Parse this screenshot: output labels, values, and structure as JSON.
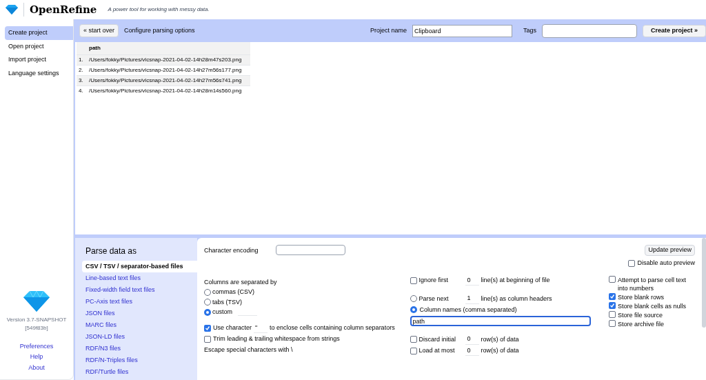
{
  "app": {
    "name": "OpenRefine",
    "tagline": "A power tool for working with messy data."
  },
  "nav": [
    {
      "label": "Create project",
      "selected": true
    },
    {
      "label": "Open project",
      "selected": false
    },
    {
      "label": "Import project",
      "selected": false
    },
    {
      "label": "Language settings",
      "selected": false
    }
  ],
  "footer": {
    "version": "Version 3.7-SNAPSHOT",
    "build": "[549f83b]",
    "links": [
      "Preferences",
      "Help",
      "About"
    ]
  },
  "toolbar": {
    "start_over": "« start over",
    "title": "Configure parsing options",
    "project_name_label": "Project name",
    "project_name": "Clipboard",
    "tags_label": "Tags",
    "create_button": "Create project »"
  },
  "preview": {
    "columns": [
      "path"
    ],
    "rows": [
      {
        "num": "1.",
        "path": "/Users/fokky/Pictures/vlcsnap-2021-04-02-14h28m47s203.png"
      },
      {
        "num": "2.",
        "path": "/Users/fokky/Pictures/vlcsnap-2021-04-02-14h27m56s177.png"
      },
      {
        "num": "3.",
        "path": "/Users/fokky/Pictures/vlcsnap-2021-04-02-14h27m56s741.png"
      },
      {
        "num": "4.",
        "path": "/Users/fokky/Pictures/vlcsnap-2021-04-02-14h28m14s560.png"
      }
    ]
  },
  "parse": {
    "heading": "Parse data as",
    "formats": [
      {
        "label": "CSV / TSV / separator-based files",
        "selected": true
      },
      {
        "label": "Line-based text files",
        "selected": false
      },
      {
        "label": "Fixed-width field text files",
        "selected": false
      },
      {
        "label": "PC-Axis text files",
        "selected": false
      },
      {
        "label": "JSON files",
        "selected": false
      },
      {
        "label": "MARC files",
        "selected": false
      },
      {
        "label": "JSON-LD files",
        "selected": false
      },
      {
        "label": "RDF/N3 files",
        "selected": false
      },
      {
        "label": "RDF/N-Triples files",
        "selected": false
      },
      {
        "label": "RDF/Turtle files",
        "selected": false
      }
    ]
  },
  "options": {
    "encoding_label": "Character encoding",
    "update_button": "Update preview",
    "disable_auto_preview": {
      "label": "Disable auto preview",
      "checked": false
    },
    "separator_label": "Columns are separated by",
    "separators": [
      {
        "label": "commas (CSV)",
        "selected": false
      },
      {
        "label": "tabs (TSV)",
        "selected": false
      },
      {
        "label": "custom",
        "selected": true
      }
    ],
    "quote": {
      "checked": true,
      "before": "Use character",
      "value": "\"",
      "after": "to enclose cells containing column separators"
    },
    "trim": {
      "checked": false,
      "label": "Trim leading & trailing whitespace from strings"
    },
    "escape": "Escape special characters with \\",
    "ignore": {
      "checked": false,
      "label": "Ignore first",
      "value": "0",
      "suffix": "line(s) at beginning of file"
    },
    "parse_next": {
      "selected": false,
      "label": "Parse next",
      "value": "1",
      "suffix": "line(s) as column headers"
    },
    "column_names": {
      "selected": true,
      "label": "Column names (comma separated)",
      "value": "path"
    },
    "discard": {
      "checked": false,
      "label": "Discard initial",
      "value": "0",
      "suffix": "row(s) of data"
    },
    "load": {
      "checked": false,
      "label": "Load at most",
      "value": "0",
      "suffix": "row(s) of data"
    },
    "flags": [
      {
        "label": "Attempt to parse cell text into numbers",
        "checked": false
      },
      {
        "label": "Store blank rows",
        "checked": true
      },
      {
        "label": "Store blank cells as nulls",
        "checked": true
      },
      {
        "label": "Store file source",
        "checked": false
      },
      {
        "label": "Store archive file",
        "checked": false
      }
    ]
  }
}
